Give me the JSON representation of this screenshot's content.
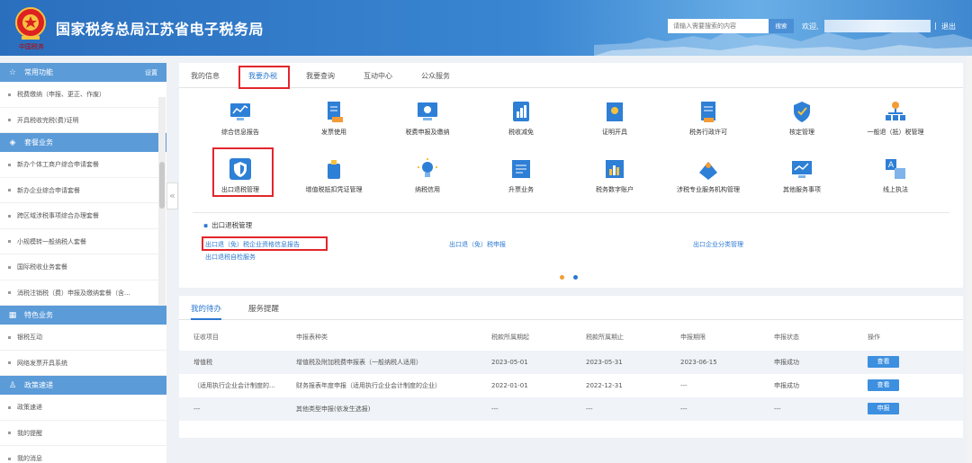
{
  "header": {
    "emblem_text": "中国税务",
    "title": "国家税务总局江苏省电子税务局",
    "search_placeholder": "请输入需要搜索的内容",
    "search_button": "搜索",
    "welcome": "欢迎,",
    "separator": "|",
    "logout": "退出"
  },
  "sidebar": {
    "sections": [
      {
        "title": "常用功能",
        "setting": "设置",
        "items": [
          "税费缴纳（申报、更正、作废）",
          "开具税收完税(费)证明"
        ]
      },
      {
        "title": "套餐业务",
        "items": [
          "新办个体工商户综合申请套餐",
          "新办企业综合申请套餐",
          "跨区域涉税事项综合办理套餐",
          "小规模转一般纳税人套餐",
          "国际税收业务套餐",
          "消税注销税（费）申报及缴纳套餐（含..."
        ]
      },
      {
        "title": "特色业务",
        "items": [
          "银税互动",
          "网络发票开具系统"
        ]
      },
      {
        "title": "政策速递",
        "items": [
          "政策速递",
          "我的提醒",
          "我的消息"
        ]
      }
    ],
    "collapse_glyph": "«"
  },
  "main_tabs": [
    "我的信息",
    "我要办税",
    "我要查询",
    "互动中心",
    "公众服务"
  ],
  "active_tab": "我要办税",
  "functions": [
    [
      "综合信息报告",
      "发票使用",
      "税费申报及缴纳",
      "税收减免",
      "证明开具",
      "税务行政许可",
      "核定管理",
      "一般退（抵）税管理"
    ],
    [
      "出口退税管理",
      "增值税抵扣凭证管理",
      "纳税信用",
      "升票业务",
      "税务数字账户",
      "涉税专业服务机构管理",
      "其他服务事项",
      "线上执法"
    ]
  ],
  "sub_panel": {
    "title": "出口退税管理",
    "links": [
      "出口退（免）税企业资格信息报告",
      "出口退（免）税申报",
      "出口企业分类管理",
      "出口退税自检服务"
    ]
  },
  "carousel": {
    "dot_colors": [
      "#f39c36",
      "#2b78d0"
    ]
  },
  "todo_tabs": [
    "我的待办",
    "服务提醒"
  ],
  "table": {
    "headers": [
      "征收项目",
      "申报表种类",
      "税款所属期起",
      "税款所属期止",
      "申报期限",
      "申报状态",
      "操作"
    ],
    "rows": [
      [
        "增值税",
        "增值税及附加税费申报表（一般纳税人适用）",
        "2023-05-01",
        "2023-05-31",
        "2023-06-15",
        "申报成功",
        "查看"
      ],
      [
        "（适用执行企业会计制度的...",
        "财务报表年度申报（适用执行企业会计制度的企业）",
        "2022-01-01",
        "2022-12-31",
        "---",
        "申报成功",
        "查看"
      ],
      [
        "---",
        "其他类型申报(依发生选报)",
        "---",
        "---",
        "---",
        "---",
        "申报"
      ]
    ]
  },
  "colors": {
    "accent": "#2b78d0",
    "highlight": "#e3262c",
    "header": "#2a6fbe",
    "sidebar_section": "#5b9bd8"
  }
}
